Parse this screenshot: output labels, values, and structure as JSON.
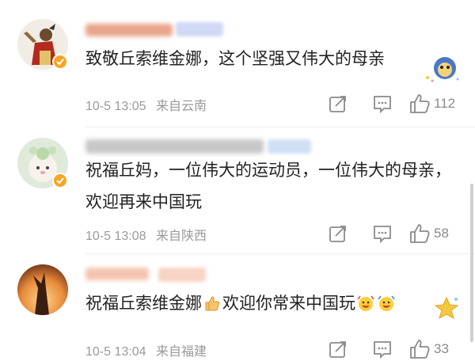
{
  "comments": [
    {
      "text": "致敬丘索维金娜，这个坚强又伟大的母亲",
      "time": "10-5 13:05",
      "location": "来自云南",
      "likes": "112"
    },
    {
      "text": "祝福丘妈，一位伟大的运动员，一位伟大的母亲，欢迎再来中国玩",
      "time": "10-5 13:08",
      "location": "来自陕西",
      "likes": "58"
    },
    {
      "text_before": "祝福丘索维金娜",
      "text_after": "欢迎你常来中国玩",
      "time": "10-5 13:04",
      "location": "来自福建",
      "likes": "33"
    }
  ],
  "icons": {
    "share": "share-icon",
    "comment": "comment-icon",
    "like": "thumbs-up-icon",
    "verified": "verified-badge-icon"
  },
  "colors": {
    "text": "#222222",
    "meta": "#9a9a9a",
    "icon": "#8a8a8a",
    "verified": "#f5a623"
  }
}
